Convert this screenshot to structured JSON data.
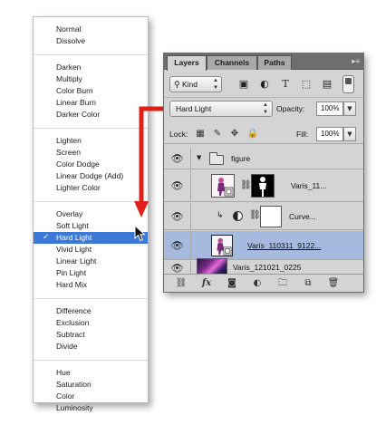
{
  "blend_menu": {
    "groups": [
      [
        "Normal",
        "Dissolve"
      ],
      [
        "Darken",
        "Multiply",
        "Color Burn",
        "Linear Burn",
        "Darker Color"
      ],
      [
        "Lighten",
        "Screen",
        "Color Dodge",
        "Linear Dodge (Add)",
        "Lighter Color"
      ],
      [
        "Overlay",
        "Soft Light",
        "Hard Light",
        "Vivid Light",
        "Linear Light",
        "Pin Light",
        "Hard Mix"
      ],
      [
        "Difference",
        "Exclusion",
        "Subtract",
        "Divide"
      ],
      [
        "Hue",
        "Saturation",
        "Color",
        "Luminosity"
      ]
    ],
    "selected": "Hard Light",
    "check_glyph": "✓"
  },
  "layers_panel": {
    "tabs": [
      "Layers",
      "Channels",
      "Paths"
    ],
    "active_tab": "Layers",
    "menu_icon": "panel-menu-icon",
    "filter": {
      "kind_glyph": "⚲",
      "kind_label": "Kind",
      "buttons": [
        "pixel-filter-icon",
        "adjustment-filter-icon",
        "type-filter-icon",
        "shape-filter-icon",
        "smart-object-filter-icon"
      ]
    },
    "blend_mode": "Hard Light",
    "opacity_label": "Opacity:",
    "opacity_value": "100%",
    "lock_label": "Lock:",
    "fill_label": "Fill:",
    "fill_value": "100%",
    "layers": [
      {
        "name": "figure",
        "type": "group"
      },
      {
        "name": "Varis_11...",
        "type": "smart-object-with-mask"
      },
      {
        "name": "Curve...",
        "type": "adjustment-curves"
      },
      {
        "name": "Varis_110311_9122...",
        "type": "smart-object",
        "selected": true
      },
      {
        "name": "Varis_121021_0225",
        "type": "pixel"
      }
    ],
    "bottom_icons": [
      "link-layers-icon",
      "fx-icon",
      "add-mask-icon",
      "new-adjustment-icon",
      "new-group-icon",
      "new-layer-icon",
      "delete-layer-icon"
    ],
    "fx_label": "fx"
  },
  "colors": {
    "menu_highlight": "#3d7ad8",
    "selected_layer": "#a6b9de",
    "callout_arrow": "#e0201b"
  }
}
